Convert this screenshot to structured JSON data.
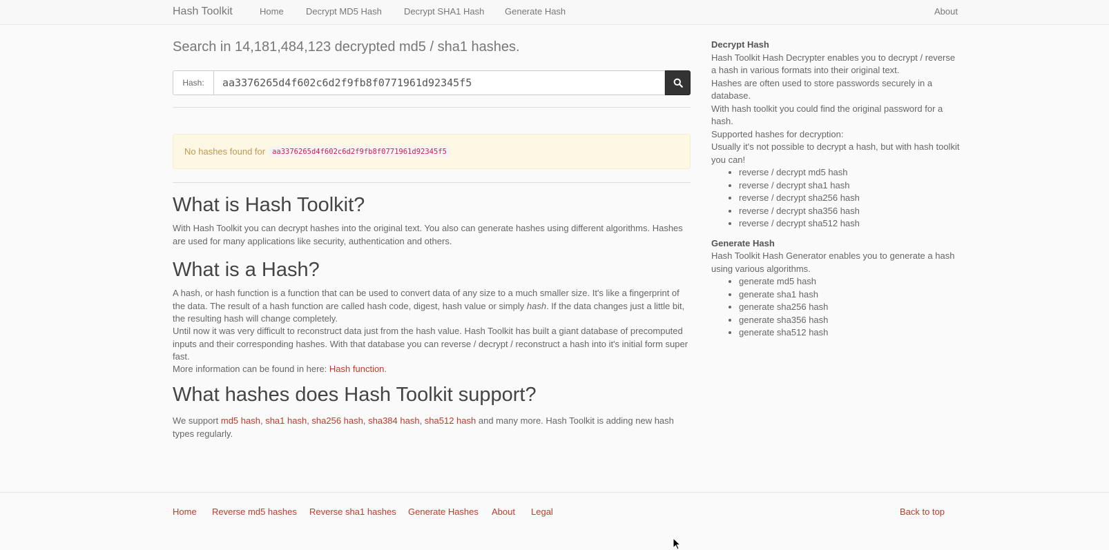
{
  "navbar": {
    "brand": "Hash Toolkit",
    "items": [
      "Home",
      "Decrypt MD5 Hash",
      "Decrypt SHA1 Hash",
      "Generate Hash"
    ],
    "about": "About"
  },
  "search": {
    "title": "Search in 14,181,484,123 decrypted md5 / sha1 hashes.",
    "label": "Hash:",
    "value": "aa3376265d4f602c6d2f9fb8f0771961d92345f5",
    "button_icon": "search-icon"
  },
  "alert": {
    "text": "No hashes found for",
    "hash": "aa3376265d4f602c6d2f9fb8f0771961d92345f5"
  },
  "sections": {
    "what_toolkit": {
      "title": "What is Hash Toolkit?",
      "text": "With Hash Toolkit you can decrypt hashes into the original text. You also can generate hashes using different algorithms. Hashes are used for many applications like security, authentication and others."
    },
    "what_hash": {
      "title": "What is a Hash?",
      "p1_a": "A hash, or hash function is a function that can be used to convert data of any size to a much smaller size. It's like a fingerprint of the data. The result of a hash function are called hash code, digest, hash value or simply ",
      "p1_em": "hash",
      "p1_b": ". If the data changes just a little bit, the resulting hash will change completely.",
      "p2": "Until now it was very difficult to reconstruct data just from the hash value. Hash Toolkit has built a giant database of precomputed inputs and their corresponding hashes. With that database you can reverse / decrypt / reconstruct a hash into it's initial form super fast.",
      "p3_a": "More information can be found in here: ",
      "p3_link": "Hash function",
      "p3_b": "."
    },
    "supported": {
      "title": "What hashes does Hash Toolkit support?",
      "prefix": "We support ",
      "links": [
        "md5 hash",
        "sha1 hash",
        "sha256 hash",
        "sha384 hash",
        "sha512 hash"
      ],
      "sep": ", ",
      "suffix": " and many more. Hash Toolkit is adding new hash types regularly."
    }
  },
  "sidebar": {
    "decrypt_title": "Decrypt Hash",
    "decrypt_lines": [
      "Hash Toolkit Hash Decrypter enables you to decrypt / reverse a hash in various formats into their original text.",
      "Hashes are often used to store passwords securely in a database.",
      "With hash toolkit you could find the original password for a hash.",
      "Supported hashes for decryption:",
      "Usually it's not possible to decrypt a hash, but with hash toolkit you can!"
    ],
    "decrypt_items": [
      "reverse / decrypt md5 hash",
      "reverse / decrypt sha1 hash",
      "reverse / decrypt sha256 hash",
      "reverse / decrypt sha356 hash",
      "reverse / decrypt sha512 hash"
    ],
    "generate_title": "Generate Hash",
    "generate_text": "Hash Toolkit Hash Generator enables you to generate a hash using various algorithms.",
    "generate_items": [
      "generate md5 hash",
      "generate sha1 hash",
      "generate sha256 hash",
      "generate sha356 hash",
      "generate sha512 hash"
    ]
  },
  "footer": {
    "links": [
      "Home",
      "Reverse md5 hashes",
      "Reverse sha1 hashes",
      "Generate Hashes",
      "About",
      "Legal"
    ],
    "back_to_top": "Back to top"
  }
}
